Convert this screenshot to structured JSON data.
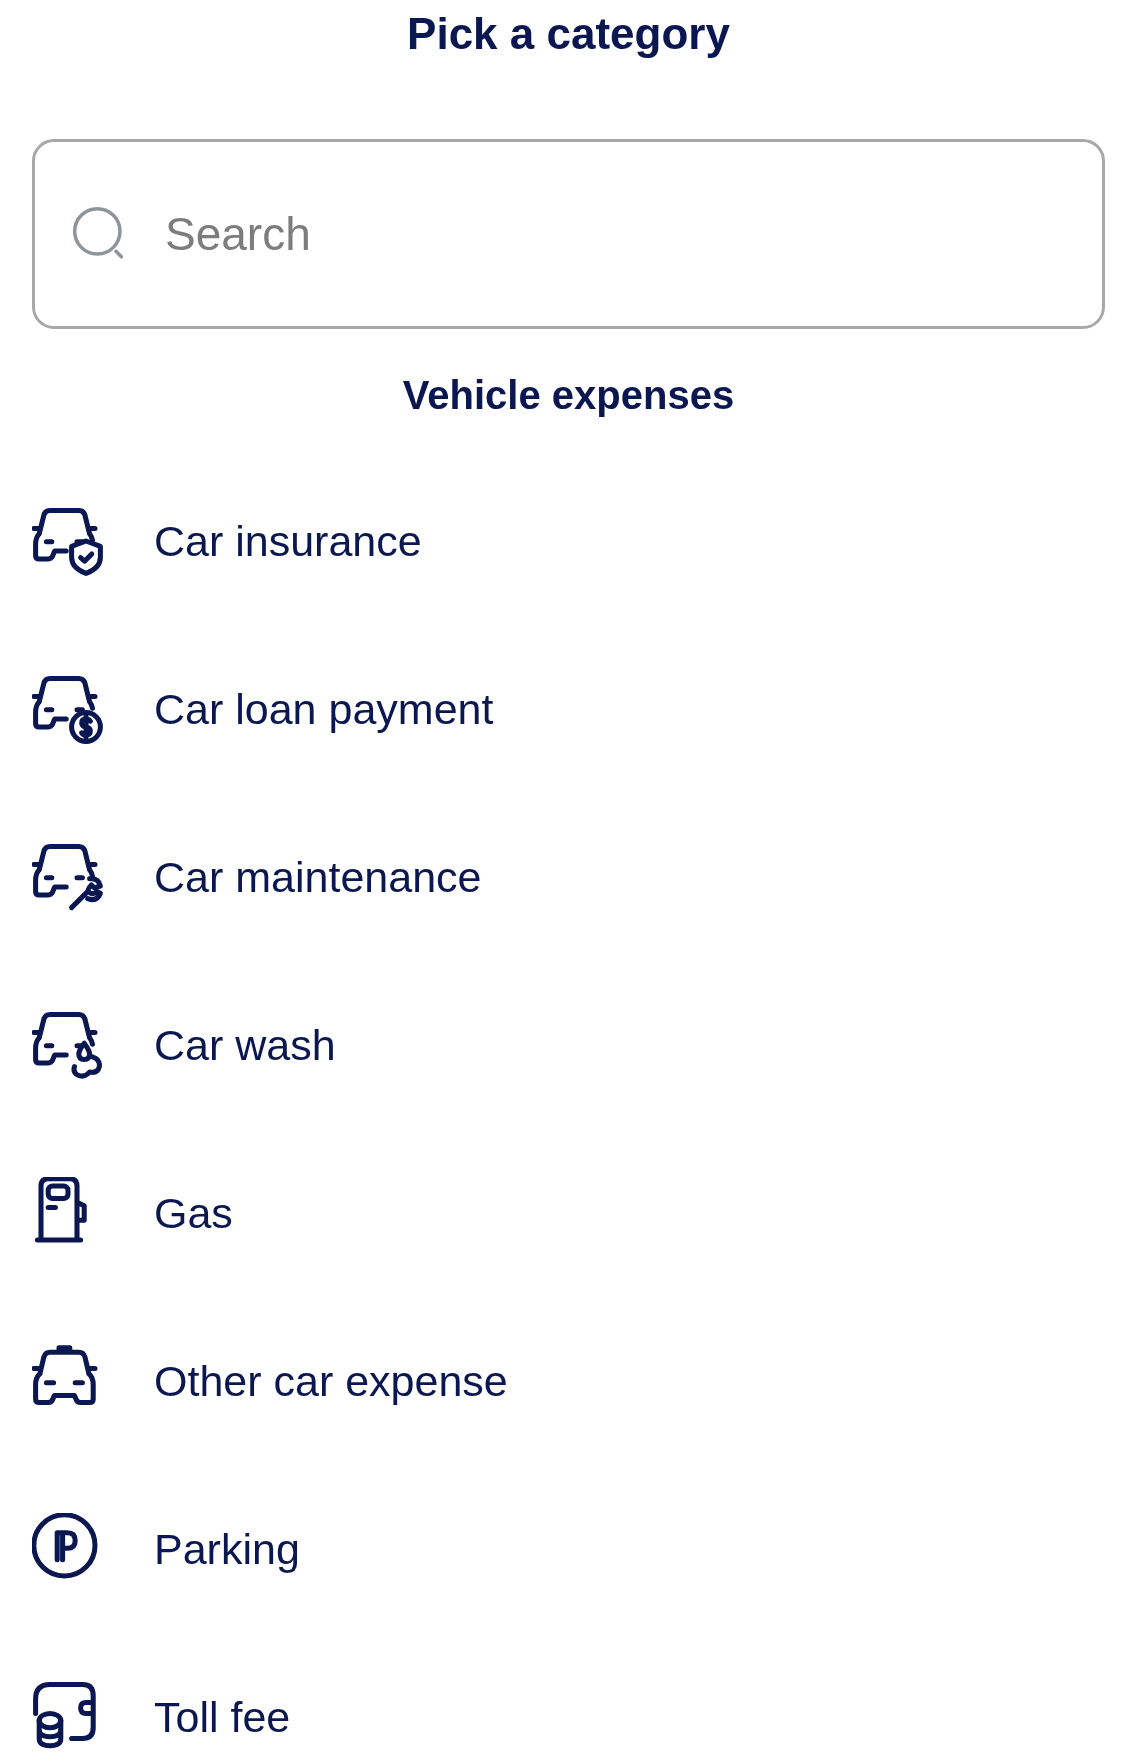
{
  "title": "Pick a category",
  "search": {
    "placeholder": "Search"
  },
  "section": {
    "title": "Vehicle expenses"
  },
  "items": [
    {
      "label": "Car insurance",
      "kind": "insurance"
    },
    {
      "label": "Car loan payment",
      "kind": "loan"
    },
    {
      "label": "Car maintenance",
      "kind": "maintenance"
    },
    {
      "label": "Car wash",
      "kind": "wash"
    },
    {
      "label": "Gas",
      "kind": "gas"
    },
    {
      "label": "Other car expense",
      "kind": "other"
    },
    {
      "label": "Parking",
      "kind": "parking"
    },
    {
      "label": "Toll fee",
      "kind": "toll"
    }
  ]
}
